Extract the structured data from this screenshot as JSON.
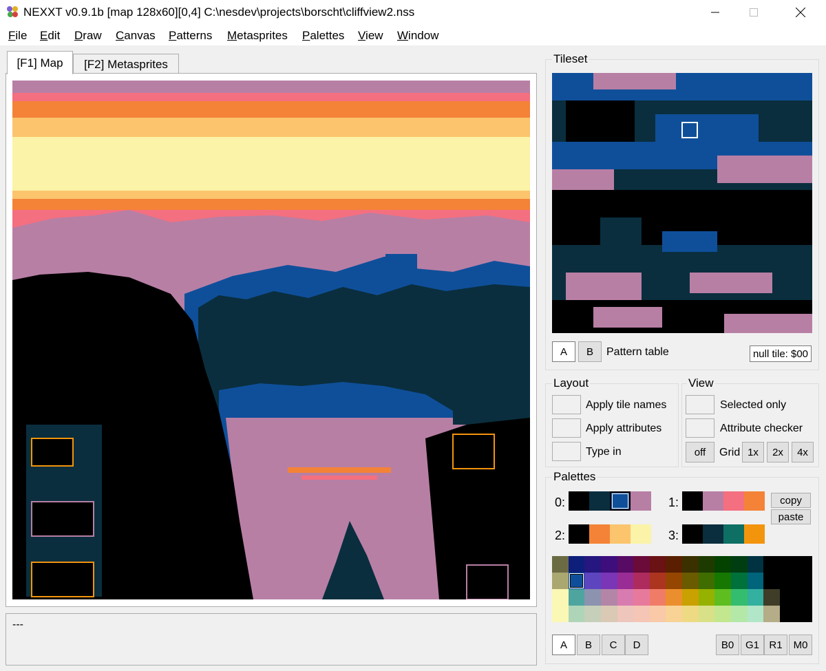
{
  "window": {
    "title": "NEXXT v0.9.1b  [map 128x60][0,4] C:\\nesdev\\projects\\borscht\\cliffview2.nss"
  },
  "menu": [
    {
      "key": "F",
      "rest": "ile"
    },
    {
      "key": "E",
      "rest": "dit"
    },
    {
      "key": "D",
      "rest": "raw"
    },
    {
      "key": "C",
      "rest": "anvas"
    },
    {
      "key": "P",
      "rest": "atterns"
    },
    {
      "key": "M",
      "rest": "etasprites"
    },
    {
      "key": "P",
      "rest": "alettes"
    },
    {
      "key": "V",
      "rest": "iew"
    },
    {
      "key": "W",
      "rest": "indow"
    }
  ],
  "tabs": {
    "map": "[F1] Map",
    "metasprites": "[F2] Metasprites"
  },
  "status": {
    "text": "---"
  },
  "tileset": {
    "title": "Tileset",
    "btn_a": "A",
    "btn_b": "B",
    "pattern_label": "Pattern table",
    "null_tile": "null tile: $00"
  },
  "layout_group": {
    "title": "Layout",
    "apply_tile_names": "Apply tile names",
    "apply_attributes": "Apply attributes",
    "type_in": "Type in"
  },
  "view_group": {
    "title": "View",
    "selected_only": "Selected only",
    "attribute_checker": "Attribute checker",
    "off": "off",
    "grid": "Grid",
    "g1": "1x",
    "g2": "2x",
    "g4": "4x"
  },
  "palettes": {
    "title": "Palettes",
    "labels": [
      "0:",
      "1:",
      "2:",
      "3:"
    ],
    "sets": [
      [
        "#000000",
        "#0a2e3e",
        "#0f4f9a",
        "#b87fa5"
      ],
      [
        "#000000",
        "#b87fa5",
        "#f46f7f",
        "#f48337"
      ],
      [
        "#000000",
        "#f48337",
        "#fbc46d",
        "#fbf3a7"
      ],
      [
        "#000000",
        "#0a2e3e",
        "#0e6f64",
        "#f3940d"
      ]
    ],
    "copy": "copy",
    "paste": "paste",
    "master": [
      [
        "#6b6b43",
        "#0d1f7a",
        "#25177f",
        "#3e0e7d",
        "#570b64",
        "#6b0b3a",
        "#6a1214",
        "#5a1f00",
        "#3b3000",
        "#1d3b00",
        "#044200",
        "#003e12",
        "#003342",
        "#000000",
        "#000000",
        "#000000"
      ],
      [
        "#aaa770",
        "#0f4f9a",
        "#5d45c0",
        "#7a36b7",
        "#9a2c95",
        "#ad2b5d",
        "#ac3520",
        "#954600",
        "#6b5b00",
        "#3f6d00",
        "#167800",
        "#00713a",
        "#00647b",
        "#000000",
        "#000000",
        "#000000"
      ],
      [
        "#fbf7b5",
        "#4ea5a0",
        "#8b93af",
        "#b385a7",
        "#d87bb0",
        "#e7799d",
        "#f07c67",
        "#eb8f2e",
        "#c9a100",
        "#95b200",
        "#5fbe1f",
        "#34bd6f",
        "#33b09f",
        "#3f3d28",
        "#000000",
        "#000000"
      ],
      [
        "#fbf7b5",
        "#aed5b7",
        "#c6cfb9",
        "#d9c9b5",
        "#efc6bc",
        "#f5c5b6",
        "#f9c9a8",
        "#f9d296",
        "#edda83",
        "#d8e187",
        "#c2e78f",
        "#b3e8a8",
        "#b2e6c8",
        "#b4ad87",
        "#000000",
        "#000000"
      ]
    ],
    "bottom_a": "A",
    "bottom_b": "B",
    "bottom_c": "C",
    "bottom_d": "D",
    "b0": "B0",
    "g1": "G1",
    "r1": "R1",
    "m0": "M0"
  }
}
